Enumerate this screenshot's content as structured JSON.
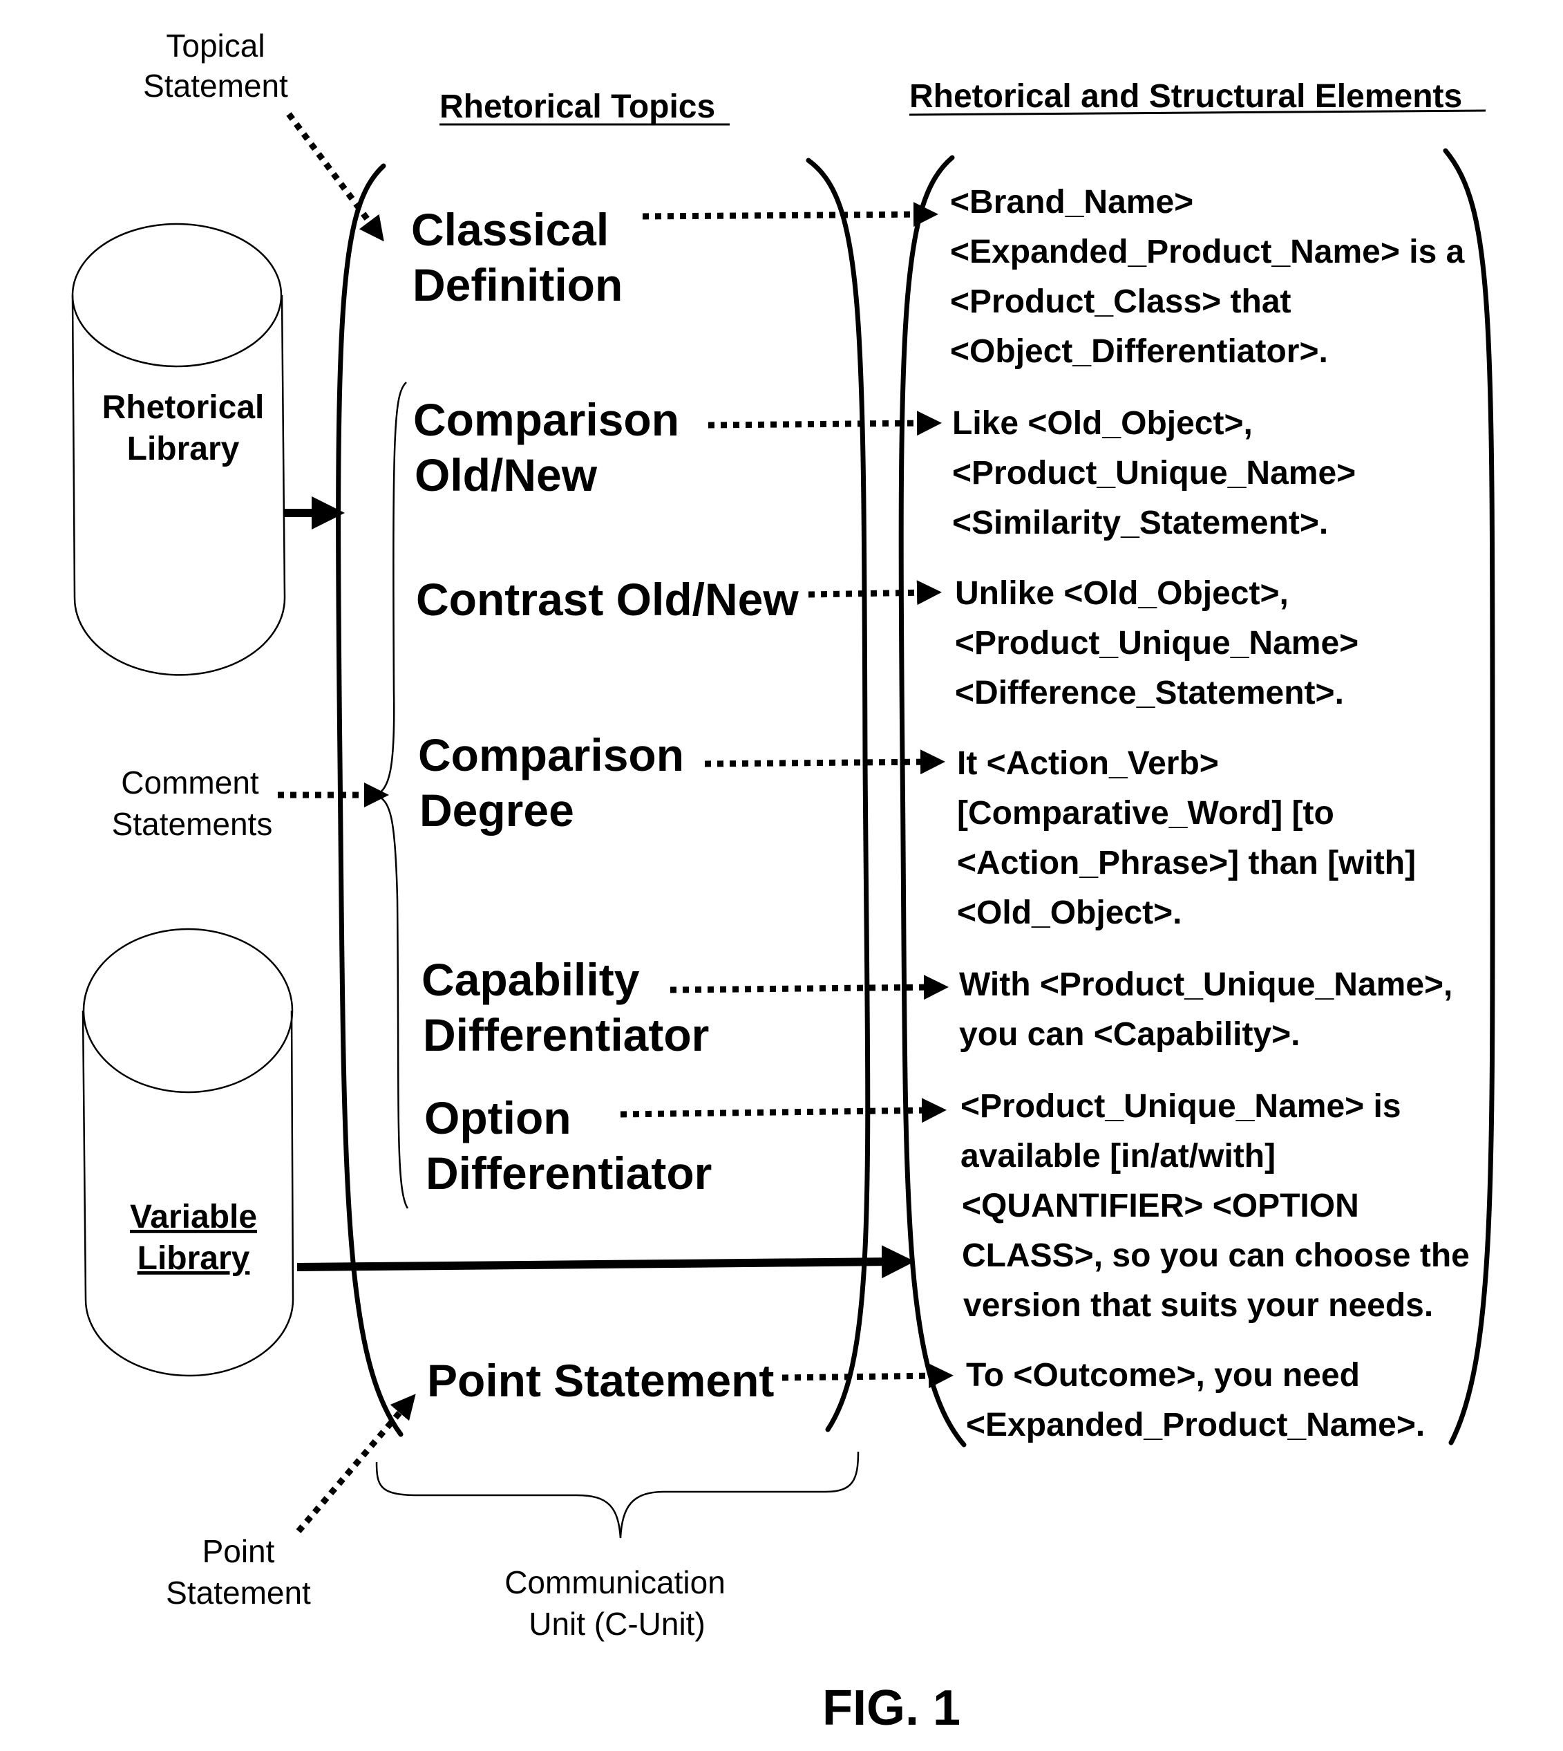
{
  "headers": {
    "rhetorical_topics": "Rhetorical Topics",
    "rhetorical_elements": "Rhetorical and Structural Elements"
  },
  "annotations": {
    "topical_statement": [
      "Topical",
      "Statement"
    ],
    "comment_statements": [
      "Comment",
      "Statements"
    ],
    "point_statement": [
      "Point",
      "Statement"
    ],
    "communication_unit": [
      "Communication",
      "Unit (C-Unit)"
    ]
  },
  "libraries": {
    "rhetorical": [
      "Rhetorical",
      "Library"
    ],
    "variable": [
      "Variable",
      "Library"
    ]
  },
  "topics": [
    {
      "lines": [
        "Classical",
        "Definition"
      ]
    },
    {
      "lines": [
        "Comparison",
        "Old/New"
      ]
    },
    {
      "lines": [
        "Contrast Old/New"
      ]
    },
    {
      "lines": [
        "Comparison",
        "Degree"
      ]
    },
    {
      "lines": [
        "Capability",
        "Differentiator"
      ]
    },
    {
      "lines": [
        "Option",
        "Differentiator"
      ]
    },
    {
      "lines": [
        "Point Statement"
      ]
    }
  ],
  "elements": [
    {
      "lines": [
        "<Brand_Name>",
        "<Expanded_Product_Name> is a",
        "<Product_Class> that",
        "<Object_Differentiator>."
      ]
    },
    {
      "lines": [
        "Like <Old_Object>,",
        "<Product_Unique_Name>",
        "<Similarity_Statement>."
      ]
    },
    {
      "lines": [
        "Unlike <Old_Object>,",
        "<Product_Unique_Name>",
        "<Difference_Statement>."
      ]
    },
    {
      "lines": [
        "It <Action_Verb>",
        "[Comparative_Word] [to",
        "<Action_Phrase>] than [with]",
        "<Old_Object>."
      ]
    },
    {
      "lines": [
        "With <Product_Unique_Name>,",
        "you can <Capability>."
      ]
    },
    {
      "lines": [
        "<Product_Unique_Name>  is",
        "available [in/at/with]",
        "<QUANTIFIER> <OPTION",
        "CLASS>, so you can choose the",
        "version that suits your needs."
      ]
    },
    {
      "lines": [
        "To <Outcome>, you need",
        "<Expanded_Product_Name>."
      ]
    }
  ],
  "figure_label": "FIG. 1"
}
